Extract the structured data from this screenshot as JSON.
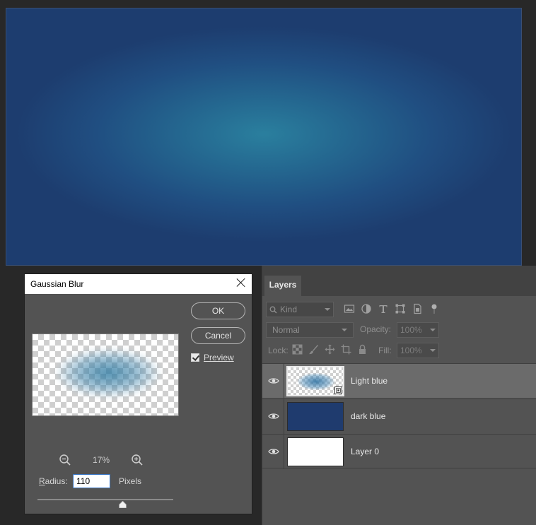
{
  "canvas": {
    "description_colors": {
      "center": "#2a7f9e",
      "edge": "#1d3d6f"
    }
  },
  "dialog": {
    "title": "Gaussian Blur",
    "ok_label": "OK",
    "cancel_label": "Cancel",
    "preview_label": "Preview",
    "preview_checked": true,
    "zoom_value": "17%",
    "radius_label_prefix": "R",
    "radius_label_rest": "adius:",
    "radius_value": "110",
    "radius_unit": "Pixels",
    "slider_level": 0.625
  },
  "layers_panel": {
    "tab_label": "Layers",
    "kind_placeholder": "Kind",
    "blend_mode": "Normal",
    "opacity_label": "Opacity:",
    "opacity_value": "100%",
    "lock_label": "Lock:",
    "fill_label": "Fill:",
    "fill_value": "100%",
    "layers": [
      {
        "name": "Light blue",
        "selected": true
      },
      {
        "name": "dark blue",
        "selected": false
      },
      {
        "name": "Layer 0",
        "selected": false
      }
    ]
  },
  "colors": {
    "dark_blue_layer": "#1f3b6e",
    "panel_bg": "#535353",
    "selected_row": "#6b6b6b",
    "accent_focus": "#3b78c6"
  }
}
